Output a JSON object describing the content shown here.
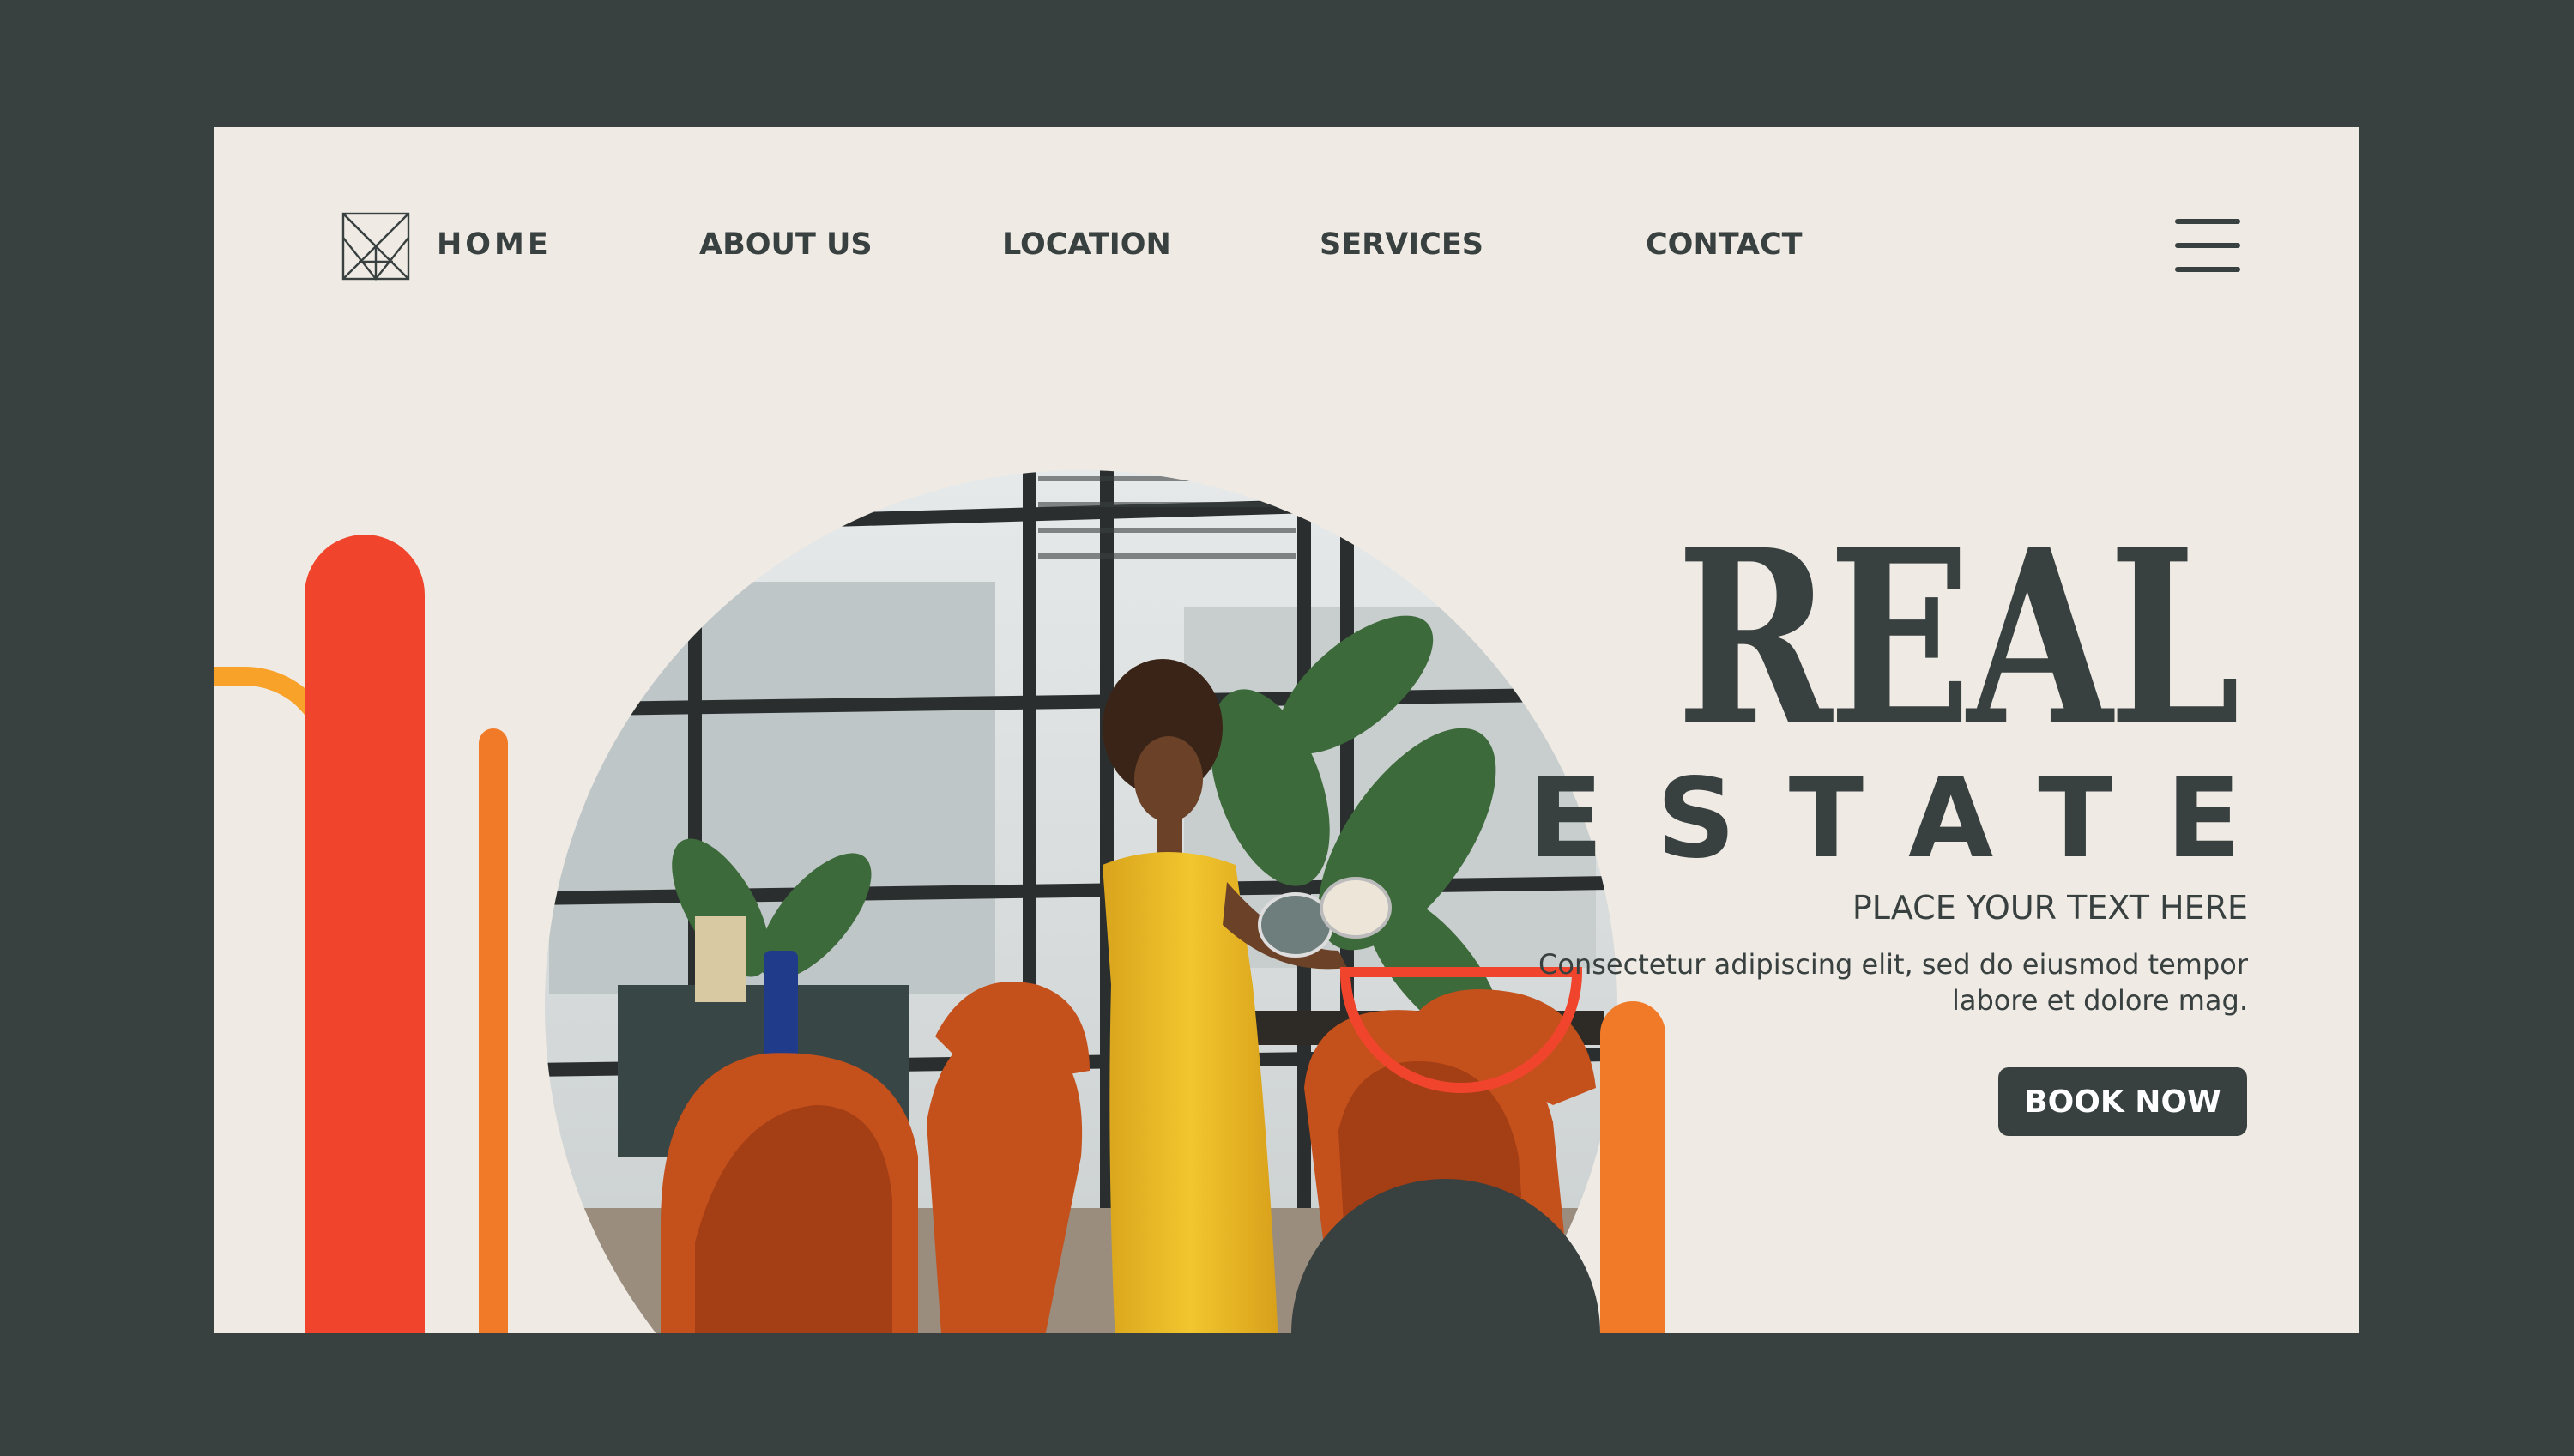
{
  "nav": {
    "home": "HOME",
    "about": "ABOUT US",
    "location": "LOCATION",
    "services": "SERVICES",
    "contact": "CONTACT",
    "menu_icon": "hamburger-icon",
    "logo_icon": "geometric-logo"
  },
  "hero": {
    "title_line1": "REAL",
    "title_line2": "ESTATE",
    "subtitle": "PLACE YOUR TEXT HERE",
    "description": "Consectetur adipiscing elit, sed do eiusmod tempor labore et dolore mag.",
    "cta": "BOOK NOW",
    "photo_subject": "woman-in-yellow-dress-in-dining-room"
  },
  "colors": {
    "background": "#384040",
    "card": "#EFEAE3",
    "text_dark": "#384040",
    "red": "#F0452C",
    "orange": "#F07A28",
    "yellow_orange": "#F9A22A"
  }
}
